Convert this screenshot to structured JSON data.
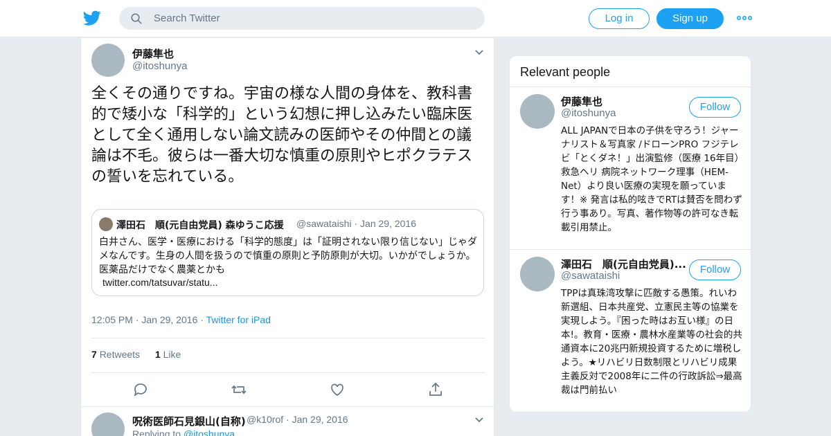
{
  "header": {
    "search_placeholder": "Search Twitter",
    "login_label": "Log in",
    "signup_label": "Sign up",
    "brand_color": "#1da1f2"
  },
  "tweet": {
    "author_name": "伊藤隼也",
    "author_handle": "@itoshunya",
    "text": "全くその通りですね。宇宙の様な人間の身体を、教科書的で矮小な「科学的」という幻想に押し込みたい臨床医として全く通用しない論文読みの医師やその仲間との議論は不毛。彼らは一番大切な慎重の原則やヒポクラテスの誓いを忘れている。",
    "quoted": {
      "author_name": "澤田石　順(元自由党員) 森ゆうこ応援",
      "author_handle": "@sawataishi",
      "date": "Jan 29, 2016",
      "text": "白井さん、医学・医療における「科学的態度」は「証明されない限り信じない」じゃダメなんです。生身の人間を扱うので慎重の原則と予防原則が大切。いかがでしょうか。医薬品だけでなく農薬とかも",
      "link": "twitter.com/tatsuvar/statu..."
    },
    "time": "12:05 PM",
    "date": "Jan 29, 2016",
    "source": "Twitter for iPad",
    "retweets_count": "7",
    "retweets_label": "Retweets",
    "likes_count": "1",
    "likes_label": "Like"
  },
  "reply": {
    "author_name": "呪術医師石見銀山(自称)",
    "author_handle": "@k10rof",
    "date": "Jan 29, 2016",
    "replying_label": "Replying to",
    "replying_to": "@itoshunya"
  },
  "sidebar": {
    "title": "Relevant people",
    "people": [
      {
        "name": "伊藤隼也",
        "handle": "@itoshunya",
        "follow_label": "Follow",
        "bio": "ALL JAPANで日本の子供を守ろう！ジャーナリスト＆写真家 /ドローンPRO フジテレビ「とくダネ！」出演監修（医療 16年目） 救急ヘリ 病院ネットワーク理事（HEM-Net）より良い医療の実現を願っています！※ 発言は私的呟きでRTは賛否を問わず行う事あり。写真、著作物等の許可なき転載引用禁止。"
      },
      {
        "name": "澤田石　順(元自由党員)...",
        "handle": "@sawataishi",
        "follow_label": "Follow",
        "bio": "TPPは真珠湾攻撃に匹敵する愚策。れいわ新選組、日本共産党、立憲民主等の協業を実現しよう。『困った時はお互い様』の日本!。教育・医療・農林水産業等の社会的共通資本に20兆円新規投資するために増税しよう。★リハビリ日数制限とリハビリ成果主義反対で2008年に二件の行政訴訟⇒最高裁は門前払い"
      }
    ]
  }
}
